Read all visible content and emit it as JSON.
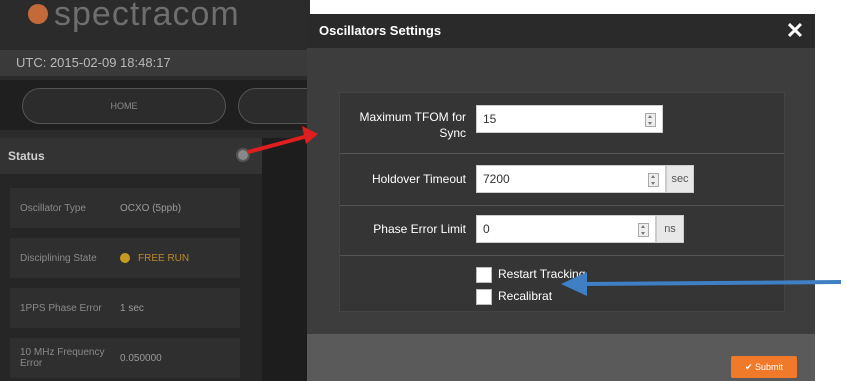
{
  "app": {
    "logo_text": "spectracom",
    "utc_text": "UTC: 2015-02-09 18:48:17",
    "nav": {
      "home_label": "HOME"
    }
  },
  "status_panel": {
    "title": "Status",
    "rows": [
      {
        "key": "Oscillator Type",
        "value": "OCXO (5ppb)"
      },
      {
        "key": "Disciplining State",
        "value": "FREE RUN"
      },
      {
        "key": "1PPS Phase Error",
        "value": "1 sec"
      },
      {
        "key": "10 MHz Frequency Error",
        "value": "0.050000"
      }
    ]
  },
  "modal": {
    "title": "Oscillators Settings",
    "close_label": "✕",
    "fields": {
      "max_tfom": {
        "label": "Maximum TFOM for Sync",
        "value": "15"
      },
      "holdover": {
        "label": "Holdover Timeout",
        "value": "7200",
        "unit": "sec"
      },
      "phase_error": {
        "label": "Phase Error Limit",
        "value": "0",
        "unit": "ns"
      }
    },
    "checkboxes": {
      "restart_tracking": "Restart Tracking",
      "recalibrate": "Recalibrat"
    },
    "submit_label": "✔ Submit"
  },
  "annotations": {
    "red_arrow_color": "#e01e1e",
    "blue_arrow_color": "#3f7fc4"
  }
}
